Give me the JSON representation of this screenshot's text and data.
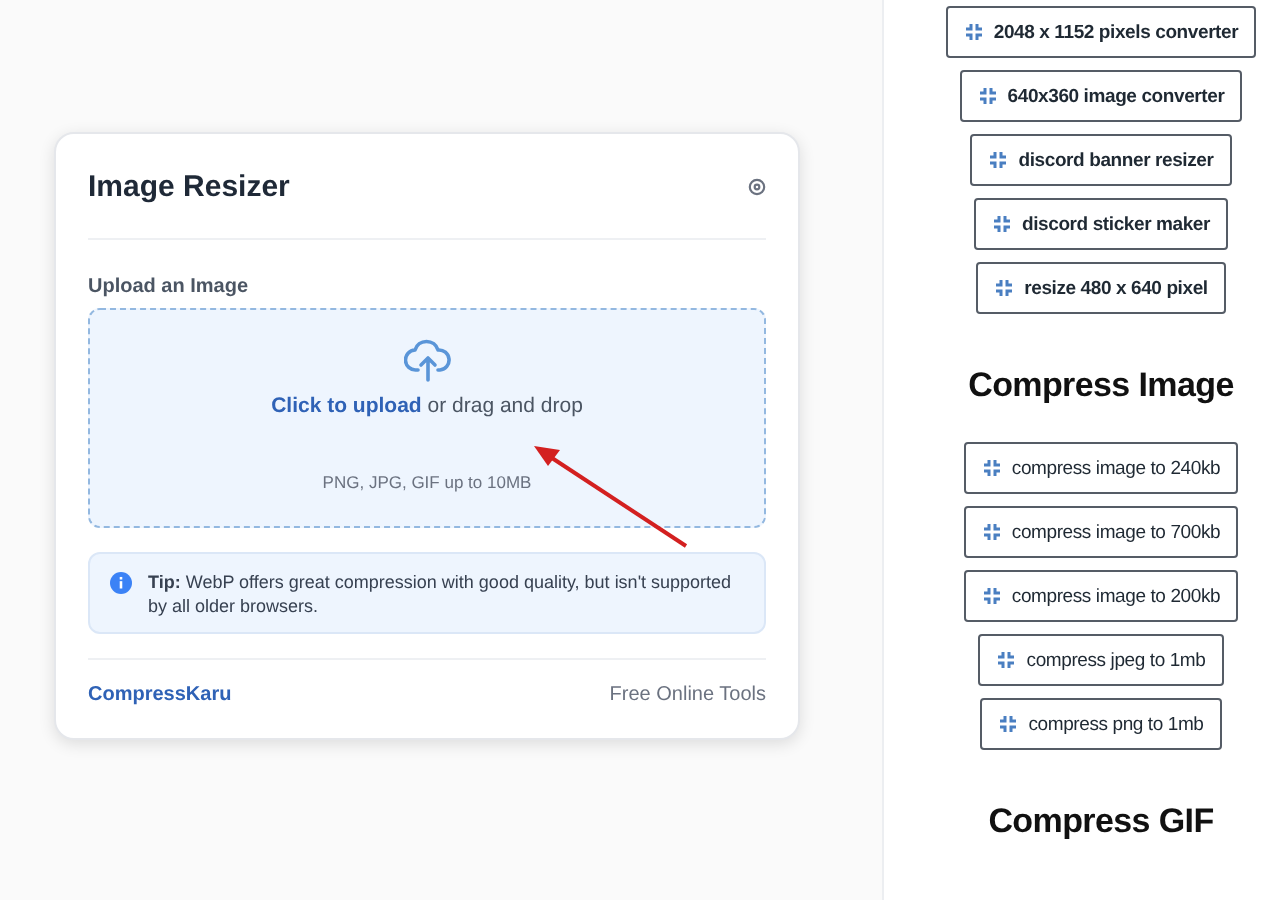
{
  "card": {
    "title": "Image Resizer",
    "upload_label": "Upload an Image",
    "upload_link": "Click to upload",
    "upload_rest": "or drag and drop",
    "upload_hint": "PNG, JPG, GIF up to 10MB",
    "tip_lead": "Tip:",
    "tip_text": "WebP offers great compression with good quality, but isn't supported by all older browsers.",
    "brand": "CompressKaru",
    "tagline": "Free Online Tools"
  },
  "sidebar": [
    {
      "kind": "link",
      "label": "2048 x 1152 pixels converter",
      "bold": true
    },
    {
      "kind": "link",
      "label": "640x360 image converter",
      "bold": true
    },
    {
      "kind": "link",
      "label": "discord banner resizer",
      "bold": true
    },
    {
      "kind": "link",
      "label": "discord sticker maker",
      "bold": true
    },
    {
      "kind": "link",
      "label": "resize 480 x 640 pixel",
      "bold": true
    },
    {
      "kind": "heading",
      "label": "Compress Image"
    },
    {
      "kind": "link",
      "label": "compress image to 240kb",
      "bold": false
    },
    {
      "kind": "link",
      "label": "compress image to 700kb",
      "bold": false
    },
    {
      "kind": "link",
      "label": "compress image to 200kb",
      "bold": false
    },
    {
      "kind": "link",
      "label": "compress jpeg to 1mb",
      "bold": false
    },
    {
      "kind": "link",
      "label": "compress png to 1mb",
      "bold": false
    },
    {
      "kind": "heading",
      "label": "Compress GIF"
    }
  ]
}
